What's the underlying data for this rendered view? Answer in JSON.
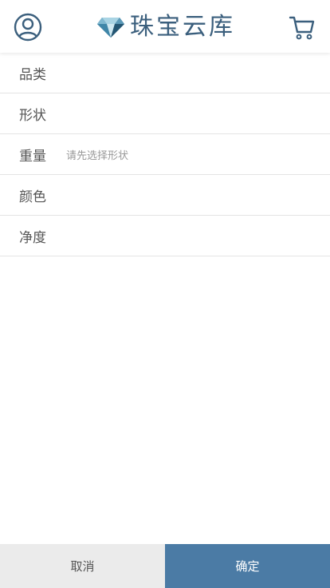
{
  "header": {
    "logo_text": "珠宝云库",
    "user_icon": "user-circle-icon",
    "cart_icon": "shopping-cart-icon",
    "logo_icon": "diamond-icon"
  },
  "filters": [
    {
      "label": "品类",
      "hint": ""
    },
    {
      "label": "形状",
      "hint": ""
    },
    {
      "label": "重量",
      "hint": "请先选择形状"
    },
    {
      "label": "颜色",
      "hint": ""
    },
    {
      "label": "净度",
      "hint": ""
    }
  ],
  "footer": {
    "cancel_label": "取消",
    "confirm_label": "确定"
  },
  "colors": {
    "primary": "#4b7ba5",
    "icon": "#3b5f7d",
    "cancel_bg": "#ebebeb"
  }
}
